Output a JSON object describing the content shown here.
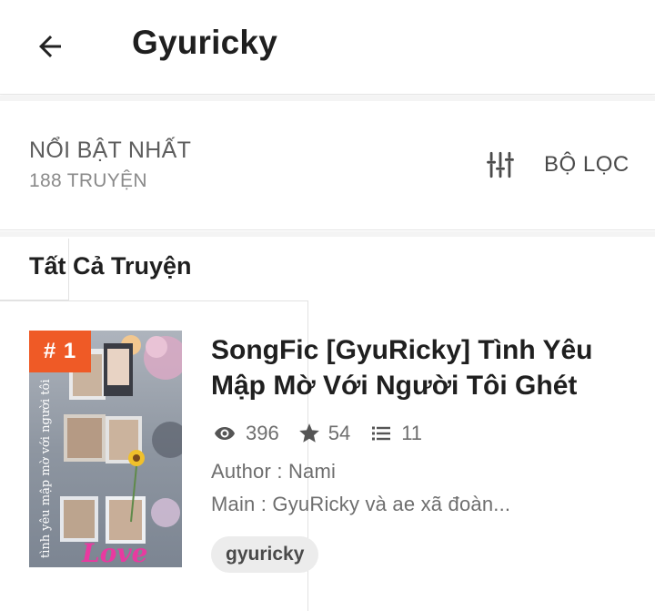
{
  "header": {
    "title": "Gyuricky",
    "back_icon": "arrow-left-icon"
  },
  "sort": {
    "title": "NỔI BẬT NHẤT",
    "count": "188 TRUYỆN",
    "filter_label": "BỘ LỌC",
    "filter_icon": "sliders-icon"
  },
  "section": {
    "title": "Tất Cả Truyện"
  },
  "stories": [
    {
      "rank": "# 1",
      "title": "SongFic [GyuRicky] Tình Yêu Mập Mờ Với Người Tôi Ghét",
      "reads": "396",
      "votes": "54",
      "parts": "11",
      "author": "Author : Nami",
      "main": "Main : GyuRicky và ae xã đoàn...",
      "tag": "gyuricky",
      "cover_text": "tình yêu mập mờ với người tôi",
      "cover_signature": "Love"
    }
  ],
  "colors": {
    "accent": "#ef5a26",
    "text_primary": "#1f1f1f",
    "text_secondary": "#6e6e6e",
    "tag_bg": "#ececec"
  }
}
